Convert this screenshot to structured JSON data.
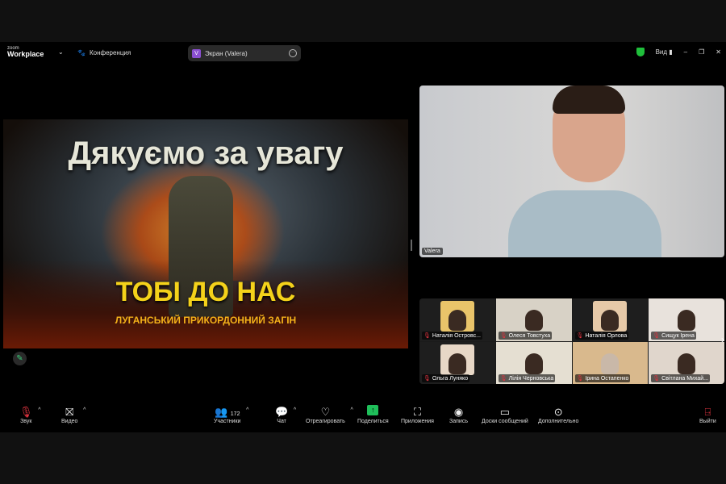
{
  "titlebar": {
    "logo_small": "zoom",
    "logo_main": "Workplace",
    "meeting_label": "Конференция",
    "screen_share": "Экран (Valera)",
    "screen_share_initial": "V",
    "view_label": "Вид"
  },
  "slide": {
    "title": "Дякуємо за увагу",
    "headline": "ТОБІ ДО НАС",
    "subtitle": "ЛУГАНСЬКИЙ ПРИКОРДОННИЙ ЗАГІН"
  },
  "speaker": {
    "name": "Valera"
  },
  "gallery": [
    {
      "name": "Наталія Островс..."
    },
    {
      "name": "Олеся Товстуха"
    },
    {
      "name": "Наталія Орлова"
    },
    {
      "name": "Сищук Ірена"
    },
    {
      "name": "Ольга Луняко"
    },
    {
      "name": "Лілія Черновська"
    },
    {
      "name": "Ірина Остапенко"
    },
    {
      "name": "Світлана Михай..."
    }
  ],
  "toolbar": {
    "audio": "Звук",
    "video": "Видео",
    "participants": "Участники",
    "participants_count": "172",
    "chat": "Чат",
    "react": "Отреагировать",
    "share": "Поделиться",
    "apps": "Приложения",
    "record": "Запись",
    "whiteboards": "Доски сообщений",
    "more": "Дополнительно",
    "leave": "Выйти"
  },
  "colors": {
    "accent_green": "#1fbf5a",
    "muted_red": "#e0333f",
    "badge_purple": "#8a4fd0"
  }
}
